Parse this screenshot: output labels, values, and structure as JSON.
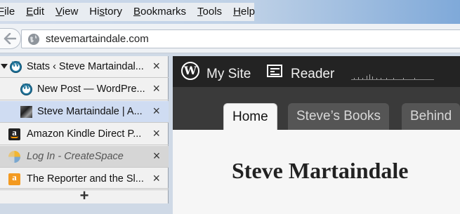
{
  "menubar": {
    "items": [
      "File",
      "Edit",
      "View",
      "History",
      "Bookmarks",
      "Tools",
      "Help"
    ],
    "accels": [
      "F",
      "E",
      "V",
      "s",
      "B",
      "T",
      "H"
    ]
  },
  "address": {
    "url": "stevemartaindale.com",
    "icon": "globe-icon"
  },
  "tabs": [
    {
      "title": "Stats ‹ Steve Martaindal...",
      "close": "×",
      "favicon": "wordpress-icon"
    },
    {
      "title": "New Post — WordPre...",
      "close": "×",
      "favicon": "wordpress-icon"
    },
    {
      "title": "Steve Martaindale | A...",
      "close": "×",
      "favicon": "avatar-icon"
    },
    {
      "title": "Amazon Kindle Direct P...",
      "close": "×",
      "favicon": "amazon-icon"
    },
    {
      "title": "Log In - CreateSpace",
      "close": "×",
      "favicon": "createspace-icon"
    },
    {
      "title": "The Reporter and the Sl...",
      "close": "×",
      "favicon": "amazon-icon"
    }
  ],
  "new_tab": "+",
  "wpbar": {
    "mysite": "My Site",
    "reader": "Reader",
    "logo_letter": "W"
  },
  "site": {
    "tabs": [
      "Home",
      "Steve’s Books",
      "Behind t"
    ],
    "title": "Steve Martaindale"
  },
  "colors": {
    "selected_tab": "#cfdcf2",
    "wp_bar": "#232323",
    "accent_blue": "#21759b"
  }
}
